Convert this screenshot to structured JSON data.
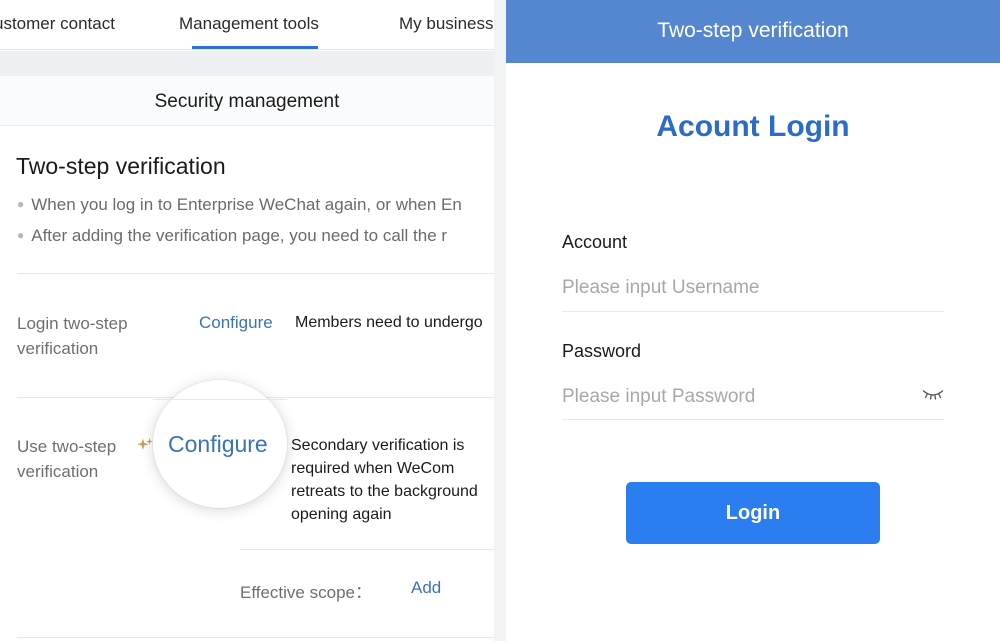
{
  "admin": {
    "tabs": [
      {
        "label": "ustomer contact"
      },
      {
        "label": "Management tools",
        "active": true
      },
      {
        "label": "My business"
      }
    ],
    "section_header": "Security management",
    "heading": "Two-step verification",
    "bullets": [
      "When you log in to Enterprise WeChat again, or when En",
      "After adding the verification page, you need to call the r"
    ],
    "login_row": {
      "label_line1": "Login two-step",
      "label_line2": "verification",
      "action": "Configure",
      "description": "Members need to undergo"
    },
    "use_row": {
      "label_line1": "Use two-step",
      "label_line2": "verification",
      "action": "Configure",
      "description_lines": [
        "Secondary verification is",
        "required when WeCom",
        "retreats to the background",
        "opening again"
      ]
    },
    "scope": {
      "label": "Effective scope：",
      "action": "Add"
    }
  },
  "mobile": {
    "window_title": "Two-step verification",
    "login_title": "Acount Login",
    "account_label": "Account",
    "account_placeholder": "Please input Username",
    "password_label": "Password",
    "password_placeholder": "Please input Password",
    "login_button": "Login"
  },
  "colors": {
    "accent_blue": "#2a7ef0",
    "header_blue": "#5487cf",
    "title_blue": "#2b6cc8",
    "link_blue": "#3a73b8",
    "tab_underline": "#2b70d6",
    "badge_gold": "#c9a15a"
  },
  "icons": {
    "badge": "sparkle-icon",
    "password_visibility": "eye-closed-icon"
  }
}
